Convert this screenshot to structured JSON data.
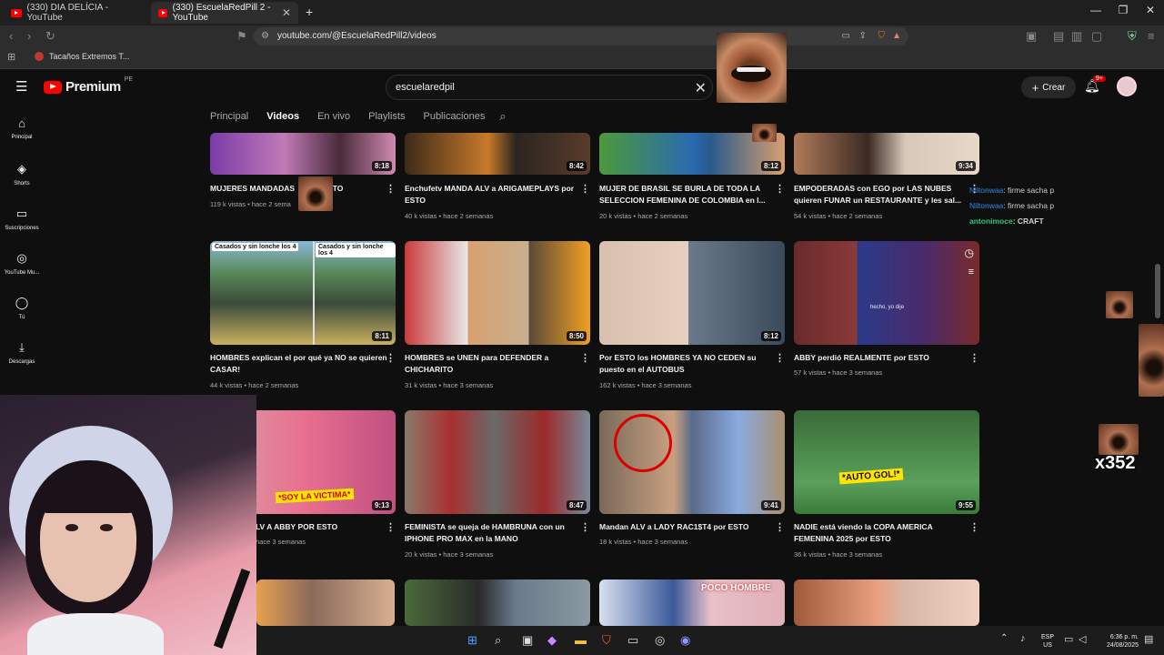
{
  "browser": {
    "tabs": [
      {
        "title": "(330) DIA DELÍCIA - YouTube"
      },
      {
        "title": "(330) EscuelaRedPill 2 - YouTube"
      }
    ],
    "url": "youtube.com/@EscuelaRedPill2/videos",
    "bookmark": "Tacaños Extremos T..."
  },
  "youtube": {
    "logo": "Premium",
    "country": "PE",
    "search_value": "escuelaredpil",
    "create_label": "Crear",
    "notif_count": "9+",
    "sidebar": [
      {
        "label": "Principal",
        "icon": "home-icon",
        "glyph": "⌂"
      },
      {
        "label": "Shorts",
        "icon": "shorts-icon",
        "glyph": "◈"
      },
      {
        "label": "Suscripciones",
        "icon": "subscriptions-icon",
        "glyph": "▭"
      },
      {
        "label": "YouTube Mu...",
        "icon": "music-icon",
        "glyph": "◎"
      },
      {
        "label": "Tú",
        "icon": "you-icon",
        "glyph": "◯"
      },
      {
        "label": "Descargas",
        "icon": "download-icon",
        "glyph": "⤓"
      }
    ],
    "channel_tabs": [
      "Principal",
      "Videos",
      "En vivo",
      "Playlists",
      "Publicaciones"
    ],
    "active_tab": "Videos",
    "videos": [
      {
        "title": "MUJERES MANDADAS",
        "title_tail": "ESTO",
        "views": "119 k vistas",
        "age": "hace 2 sema",
        "duration": "8:18"
      },
      {
        "title": "Enchufetv MANDA ALV a ARIGAMEPLAYS por ESTO",
        "views": "40 k vistas",
        "age": "hace 2 semanas",
        "duration": "8:42"
      },
      {
        "title": "MUJER DE BRASIL SE BURLA DE TODA LA SELECCION FEMENINA DE COLOMBIA en l...",
        "views": "20 k vistas",
        "age": "hace 2 semanas",
        "duration": "8:12"
      },
      {
        "title": "EMPODERADAS con EGO por LAS NUBES quieren FUNAR un RESTAURANTE y les sal...",
        "views": "54 k vistas",
        "age": "hace 2 semanas",
        "duration": "9:34"
      },
      {
        "title": "HOMBRES explican el por qué ya NO se quieren CASAR!",
        "views": "44 k vistas",
        "age": "hace 2 semanas",
        "duration": "8:11",
        "thumb_text": "Casados y sin lonche los 4"
      },
      {
        "title": "HOMBRES se UNEN para DEFENDER a CHICHARITO",
        "views": "31 k vistas",
        "age": "hace 3 semanas",
        "duration": "8:50"
      },
      {
        "title": "Por ESTO los HOMBRES YA NO CEDEN su puesto en el AUTOBUS",
        "views": "162 k vistas",
        "age": "hace 3 semanas",
        "duration": "8:12"
      },
      {
        "title": "ABBY perdió REALMENTE por ESTO",
        "views": "57 k vistas",
        "age": "hace 3 semanas",
        "duration": "",
        "thumb_text": "hecho, yo dije"
      },
      {
        "title": "LV A ABBY POR ESTO",
        "views": "",
        "age": "hace 3 semanas",
        "duration": "9:13",
        "thumb_text": "*SOY LA VICTIMA*"
      },
      {
        "title": "FEMINISTA se queja de HAMBRUNA con un IPHONE PRO MAX en la MANO",
        "views": "20 k vistas",
        "age": "hace 3 semanas",
        "duration": "8:47"
      },
      {
        "title": "Mandan ALV a LADY RAC1$T4 por ESTO",
        "views": "18 k vistas",
        "age": "hace 3 semanas",
        "duration": "9:41"
      },
      {
        "title": "NADIE está viendo la COPA AMERICA FEMENINA 2025 por ESTO",
        "views": "36 k vistas",
        "age": "hace 3 semanas",
        "duration": "9:55",
        "thumb_text": "*AUTO GOL!*"
      },
      {
        "thumb_text": "POCO HOMBRE"
      }
    ]
  },
  "chat": [
    {
      "user": "Niltonwaa",
      "msg": ": firme sacha p"
    },
    {
      "user": "Niltonwaa",
      "msg": ": firme sacha p"
    },
    {
      "user": "antonimoce",
      "msg": ": CRAFT"
    }
  ],
  "overlay": {
    "multiplier": "x352"
  },
  "taskbar": {
    "lang": "ESP",
    "region": "US",
    "time": "6:36 p. m.",
    "date": "24/08/2025"
  },
  "colors": {
    "brand_red": "#ff0000",
    "bg": "#0f0f0f",
    "chat_user": "#2f8ae6",
    "chat_user_green": "#34c77b"
  }
}
